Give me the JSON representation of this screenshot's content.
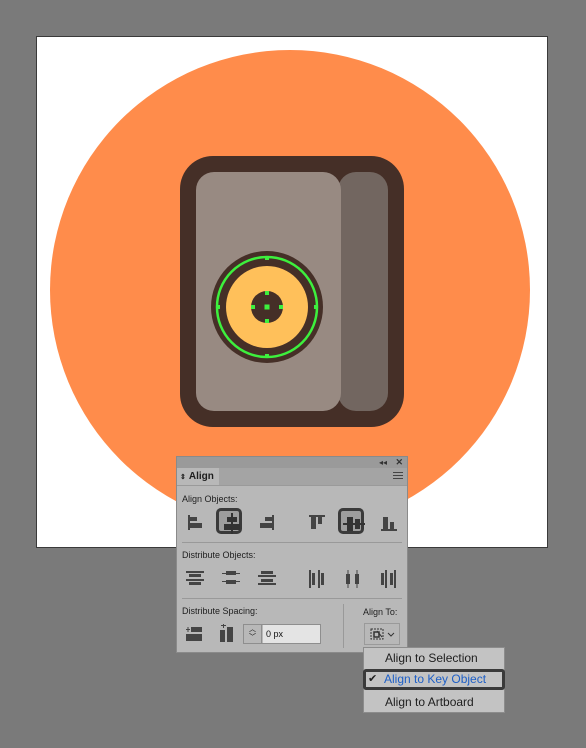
{
  "artboard": {
    "colors": {
      "background_circle": "#ff8c4b",
      "outline": "#452f27",
      "card_front": "#988a82",
      "card_back": "#726660",
      "coin": "#ffc05a",
      "selection": "#3df03d"
    }
  },
  "align_panel": {
    "tab_title": "Align",
    "align_objects_label": "Align Objects:",
    "distribute_objects_label": "Distribute Objects:",
    "distribute_spacing_label": "Distribute Spacing:",
    "align_to_label": "Align To:",
    "spacing_value": "0 px",
    "align_objects_buttons": [
      {
        "name": "horizontal-align-left",
        "selected": false
      },
      {
        "name": "horizontal-align-center",
        "selected": true
      },
      {
        "name": "horizontal-align-right",
        "selected": false
      },
      {
        "name": "vertical-align-top",
        "selected": false
      },
      {
        "name": "vertical-align-center",
        "selected": true
      },
      {
        "name": "vertical-align-bottom",
        "selected": false
      }
    ]
  },
  "align_to_menu": {
    "items": [
      {
        "label": "Align to Selection",
        "checked": false
      },
      {
        "label": "Align to Key Object",
        "checked": true
      },
      {
        "label": "Align to Artboard",
        "checked": false
      }
    ],
    "checkmark": "✔"
  }
}
